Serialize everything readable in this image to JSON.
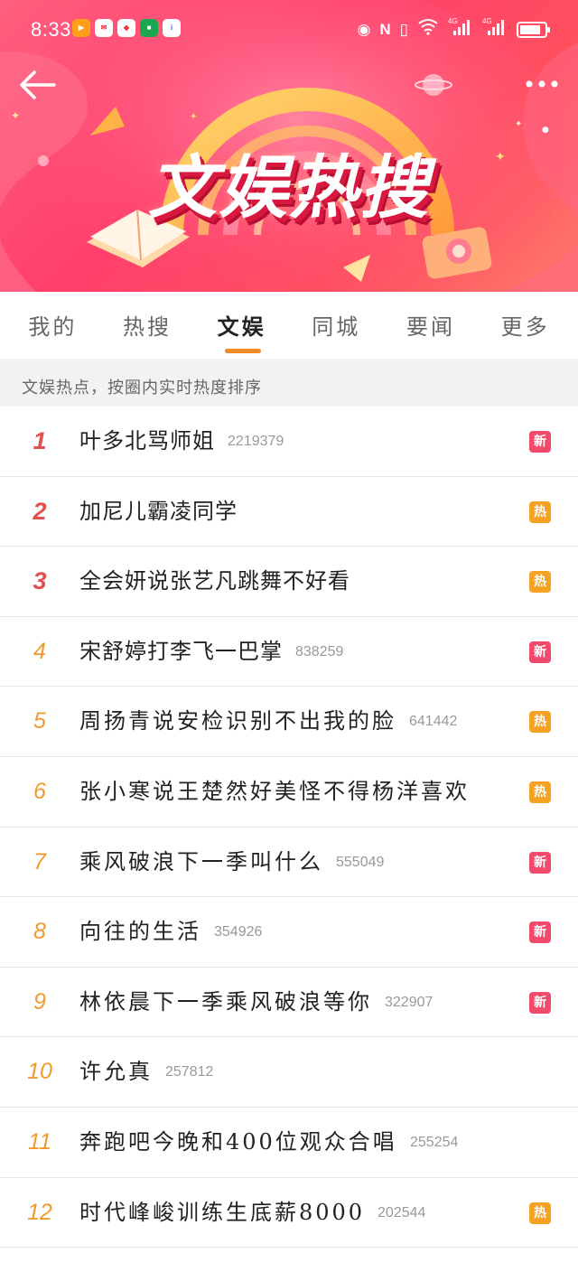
{
  "status_bar": {
    "time": "8:33",
    "battery_level": 0.85,
    "net_labels": [
      "4G",
      "4G"
    ]
  },
  "header": {
    "banner_title": "文娱热搜",
    "back_icon": "back-arrow-icon",
    "more_icon": "more-dots-icon"
  },
  "tabs": [
    {
      "label": "我的",
      "active": false
    },
    {
      "label": "热搜",
      "active": false
    },
    {
      "label": "文娱",
      "active": true
    },
    {
      "label": "同城",
      "active": false
    },
    {
      "label": "要闻",
      "active": false
    },
    {
      "label": "更多",
      "active": false
    }
  ],
  "subtitle": "文娱热点，按圈内实时热度排序",
  "badges": {
    "new": "新",
    "hot": "热"
  },
  "colors": {
    "accent": "#f08a26",
    "badge_new": "#f04b6d",
    "badge_hot": "#f5a223",
    "rank_top": "#e5504e",
    "rank_other": "#f09a2e"
  },
  "list": [
    {
      "rank": "1",
      "title": "叶多北骂师姐",
      "count": "2219379",
      "badge": "新"
    },
    {
      "rank": "2",
      "title": "加尼儿霸凌同学",
      "count": "",
      "badge": "热"
    },
    {
      "rank": "3",
      "title": "全会妍说张艺凡跳舞不好看",
      "count": "",
      "badge": "热"
    },
    {
      "rank": "4",
      "title": "宋舒婷打李飞一巴掌",
      "count": "838259",
      "badge": "新"
    },
    {
      "rank": "5",
      "title": "周扬青说安检识别不出我的脸",
      "count": "641442",
      "badge": "热"
    },
    {
      "rank": "6",
      "title": "张小寒说王楚然好美怪不得杨洋喜欢",
      "count": "",
      "badge": "热"
    },
    {
      "rank": "7",
      "title": "乘风破浪下一季叫什么",
      "count": "555049",
      "badge": "新"
    },
    {
      "rank": "8",
      "title": "向往的生活",
      "count": "354926",
      "badge": "新"
    },
    {
      "rank": "9",
      "title": "林依晨下一季乘风破浪等你",
      "count": "322907",
      "badge": "新"
    },
    {
      "rank": "10",
      "title": "许允真",
      "count": "257812",
      "badge": ""
    },
    {
      "rank": "11",
      "title": "奔跑吧今晚和400位观众合唱",
      "count": "255254",
      "badge": ""
    },
    {
      "rank": "12",
      "title": "时代峰峻训练生底薪8000",
      "count": "202544",
      "badge": "热"
    }
  ]
}
